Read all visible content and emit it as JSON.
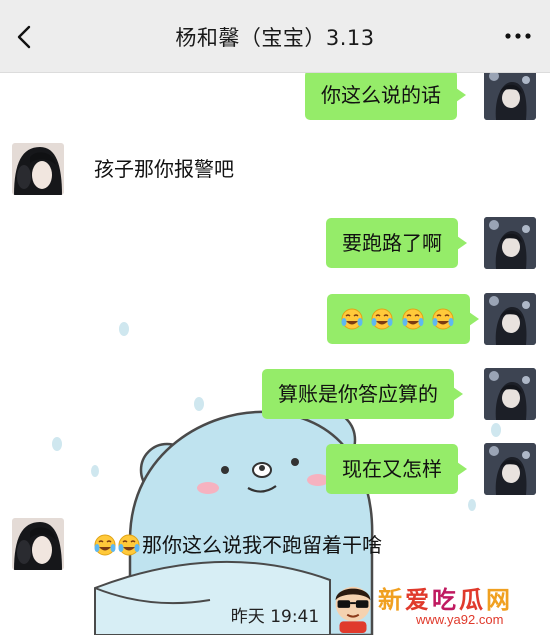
{
  "header": {
    "title": "杨和馨（宝宝）3.13",
    "back_icon": "chevron-left-icon",
    "more_icon": "more-dots-icon"
  },
  "messages": [
    {
      "sender": "me",
      "text": "你这么说的话"
    },
    {
      "sender": "them",
      "text": "孩子那你报警吧"
    },
    {
      "sender": "me",
      "text": "要跑路了啊"
    },
    {
      "sender": "me",
      "emoji_count": 4,
      "emoji_icon": "laughing-crying-emoji-icon"
    },
    {
      "sender": "me",
      "text": "算账是你答应算的"
    },
    {
      "sender": "me",
      "text": "现在又怎样"
    },
    {
      "sender": "them",
      "emoji_count": 2,
      "emoji_icon": "laughing-crying-emoji-icon",
      "text": "那你这么说我不跑留着干啥"
    }
  ],
  "timestamp": "昨天 19:41",
  "watermark": {
    "title": "新爱吃瓜网",
    "url": "www.ya92.com",
    "title_colors": [
      "#f0a020",
      "#e03a2c",
      "#c01a60",
      "#e03a2c",
      "#f0a020"
    ]
  },
  "colors": {
    "bubble_me": "#95ec69",
    "header_bg": "#ededed"
  }
}
